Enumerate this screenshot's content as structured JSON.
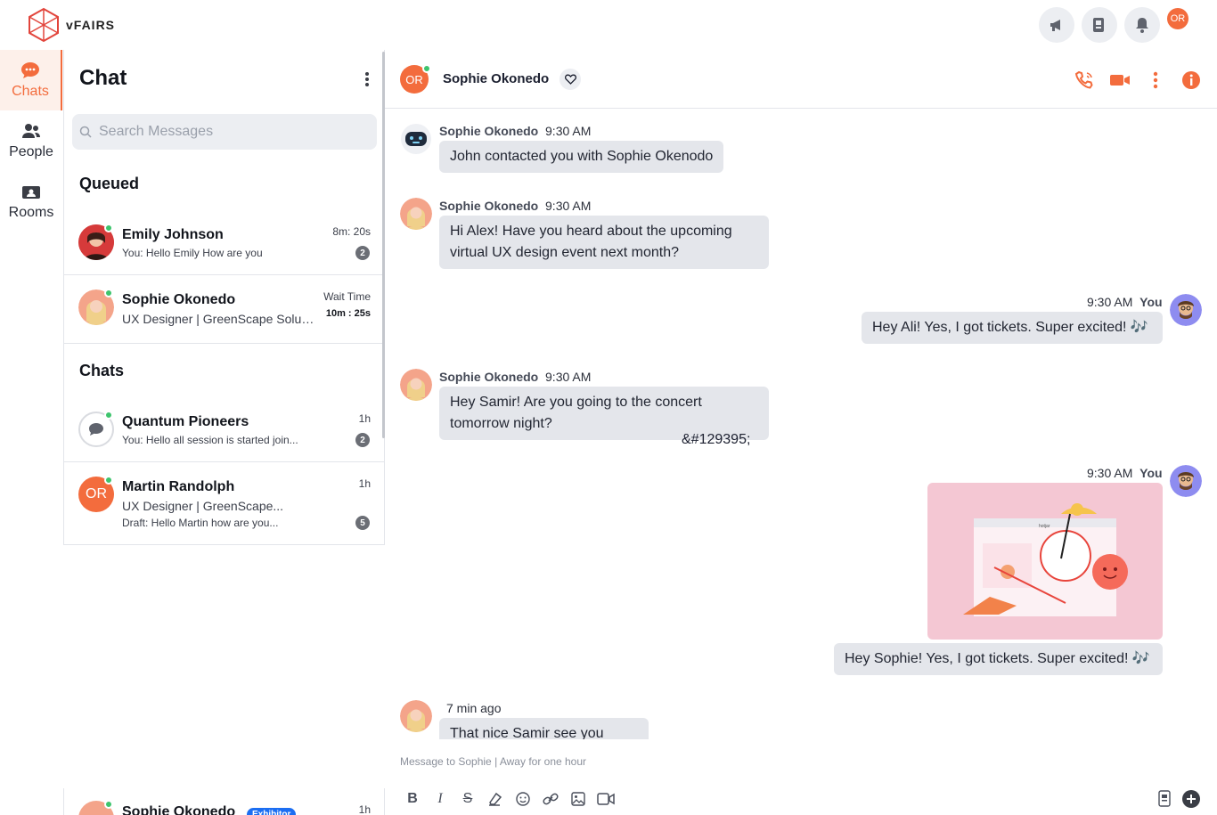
{
  "brand": {
    "name": "vFAIRS",
    "color": "#f36c3d"
  },
  "topbar": {
    "icons": [
      "megaphone-icon",
      "contact-card-icon",
      "bell-icon"
    ],
    "user_initials": "OR"
  },
  "rail": {
    "items": [
      {
        "label": "Chats",
        "icon": "chat-bubble-icon",
        "active": true
      },
      {
        "label": "People",
        "icon": "people-icon",
        "active": false
      },
      {
        "label": "Rooms",
        "icon": "rooms-icon",
        "active": false
      }
    ]
  },
  "chat_list": {
    "title": "Chat",
    "search_placeholder": "Search Messages",
    "queued_title": "Queued",
    "chats_title": "Chats",
    "queued": [
      {
        "name": "Emily Johnson",
        "preview": "You: Hello Emily How are you",
        "time": "8m: 20s",
        "badge": "2"
      },
      {
        "name": "Sophie Okonedo",
        "subtitle": "UX Designer | GreenScape Solut...",
        "time_label": "Wait Time",
        "time": "10m : 25s"
      }
    ],
    "chats": [
      {
        "name": "Quantum Pioneers",
        "preview": "You: Hello all session is started join...",
        "time": "1h",
        "badge": "2"
      },
      {
        "name": "Martin Randolph",
        "avatar_initials": "OR",
        "subtitle": "UX Designer | GreenScape...",
        "preview": "Draft: Hello Martin how are you...",
        "time": "1h",
        "badge": "5"
      }
    ],
    "bottom": {
      "name": "Sophie Okonedo",
      "tag": "Exhibitor",
      "time": "1h"
    }
  },
  "conversation": {
    "contact_name": "Sophie Okonedo",
    "contact_initials": "OR",
    "actions": [
      "call-icon",
      "video-icon",
      "more-icon",
      "info-icon"
    ],
    "messages": [
      {
        "sender": "Sophie Okonedo",
        "time": "9:30 AM",
        "text": "John contacted you with Sophie Okenodo"
      },
      {
        "sender": "Sophie Okonedo",
        "time": "9:30 AM",
        "text": "Hi Alex! Have you heard about the upcoming virtual UX design event next month?"
      },
      {
        "sender": "You",
        "time": "9:30 AM",
        "text": "Hey Ali! Yes, I got tickets. Super excited! 🎶"
      },
      {
        "sender": "Sophie Okonedo",
        "time": "9:30 AM",
        "text": "Hey Samir! Are you going to the concert tomorrow night?",
        "reaction": "&#129395;"
      },
      {
        "sender": "You",
        "time": "9:30 AM",
        "text": "Hey Sophie! Yes, I got tickets. Super excited! 🎶"
      },
      {
        "time": "7 min ago",
        "text": "That nice Samir see you there"
      }
    ],
    "image_brand": "hotjar",
    "composer_hint": "Message to Sophie | Away for one hour",
    "toolbar": [
      "bold-icon",
      "italic-icon",
      "strikethrough-icon",
      "format-clear-icon",
      "emoji-icon",
      "link-icon",
      "image-icon",
      "video-icon"
    ]
  }
}
